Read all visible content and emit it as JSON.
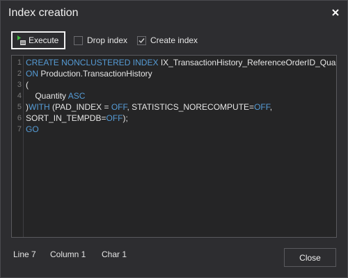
{
  "window": {
    "title": "Index creation",
    "close_icon": "close-icon"
  },
  "toolbar": {
    "execute_label": "Execute",
    "execute_icon": "execute-icon",
    "drop_index_label": "Drop index",
    "drop_index_checked": false,
    "create_index_label": "Create index",
    "create_index_checked": true
  },
  "editor": {
    "line_numbers": [
      "1",
      "2",
      "3",
      "4",
      "5",
      "6",
      "7"
    ],
    "lines": [
      {
        "tokens": [
          {
            "t": "CREATE NONCLUSTERED INDEX ",
            "k": true
          },
          {
            "t": "IX_TransactionHistory_ReferenceOrderID_Quantity",
            "k": false
          }
        ]
      },
      {
        "tokens": [
          {
            "t": "ON ",
            "k": true
          },
          {
            "t": "Production.TransactionHistory",
            "k": false
          }
        ]
      },
      {
        "tokens": [
          {
            "t": "(",
            "k": false
          }
        ]
      },
      {
        "tokens": [
          {
            "t": "    Quantity ",
            "k": false
          },
          {
            "t": "ASC",
            "k": true
          }
        ]
      },
      {
        "tokens": [
          {
            "t": ")",
            "k": false
          },
          {
            "t": "WITH ",
            "k": true
          },
          {
            "t": "(PAD_INDEX = ",
            "k": false
          },
          {
            "t": "OFF",
            "k": true
          },
          {
            "t": ", STATISTICS_NORECOMPUTE=",
            "k": false
          },
          {
            "t": "OFF",
            "k": true
          },
          {
            "t": ",",
            "k": false
          }
        ]
      },
      {
        "tokens": [
          {
            "t": "SORT_IN_TEMPDB=",
            "k": false
          },
          {
            "t": "OFF",
            "k": true
          },
          {
            "t": ");",
            "k": false
          }
        ]
      },
      {
        "tokens": [
          {
            "t": "GO",
            "k": true
          }
        ]
      },
      {
        "tokens": []
      }
    ]
  },
  "status": {
    "line": "Line 7",
    "column": "Column 1",
    "char": "Char 1"
  },
  "footer": {
    "close_label": "Close"
  },
  "colors": {
    "keyword": "#569cd6",
    "background": "#2d2d30"
  }
}
